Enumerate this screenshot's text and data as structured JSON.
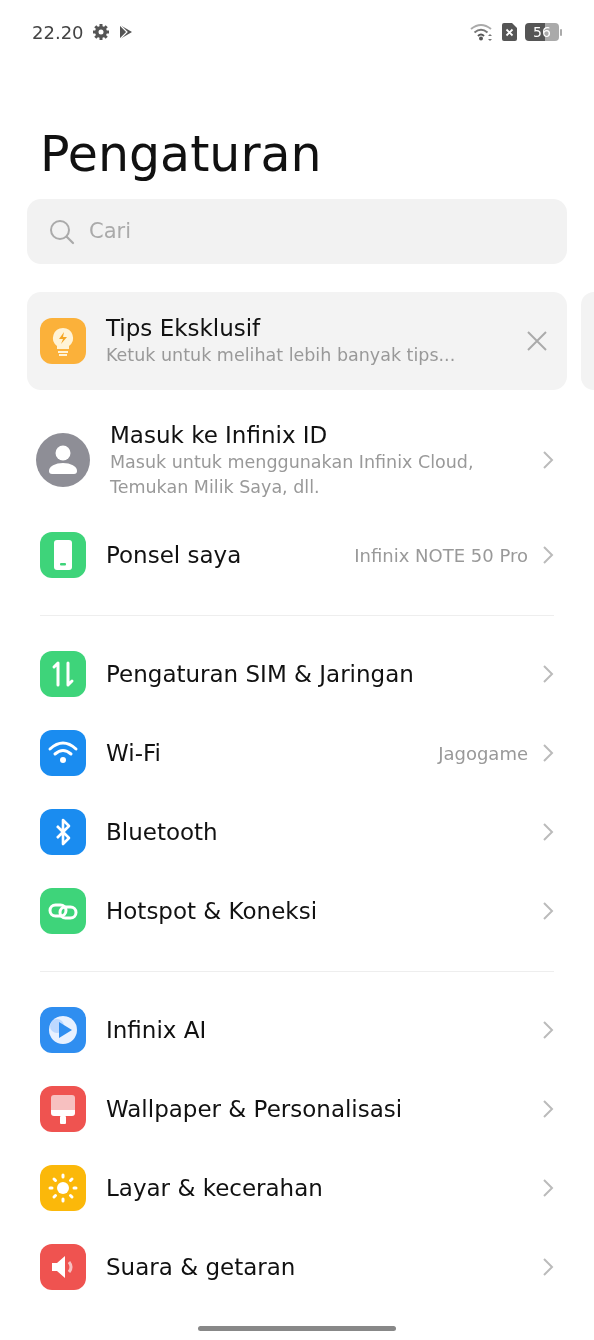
{
  "status_bar": {
    "time": "22.20",
    "battery": "56"
  },
  "title": "Pengaturan",
  "search": {
    "placeholder": "Cari"
  },
  "tip_card": {
    "title": "Tips Eksklusif",
    "subtitle": "Ketuk untuk melihat lebih banyak tips...",
    "color": "#fbb13a"
  },
  "groups": [
    {
      "items": [
        {
          "kind": "account",
          "title": "Masuk ke Infinix ID",
          "subtitle": "Masuk untuk menggunakan Infinix Cloud, Temukan Milik Saya, dll.",
          "color": "#8e8e96"
        },
        {
          "kind": "item",
          "title": "Ponsel saya",
          "value": "Infinix NOTE 50 Pro",
          "color": "#3ed47a"
        }
      ]
    },
    {
      "items": [
        {
          "kind": "item",
          "title": "Pengaturan SIM & Jaringan",
          "color": "#3ed47a"
        },
        {
          "kind": "item",
          "title": "Wi-Fi",
          "value": "Jagogame",
          "color": "#1a8cf0"
        },
        {
          "kind": "item",
          "title": "Bluetooth",
          "color": "#1a8cf0"
        },
        {
          "kind": "item",
          "title": "Hotspot & Koneksi",
          "color": "#3ed47a"
        }
      ]
    },
    {
      "items": [
        {
          "kind": "item",
          "title": "Infinix AI",
          "color": "#2f8ef0"
        },
        {
          "kind": "item",
          "title": "Wallpaper & Personalisasi",
          "color": "#ef5350"
        },
        {
          "kind": "item",
          "title": "Layar & kecerahan",
          "color": "#fbb80a"
        },
        {
          "kind": "item",
          "title": "Suara & getaran",
          "color": "#ef5350"
        }
      ]
    }
  ]
}
